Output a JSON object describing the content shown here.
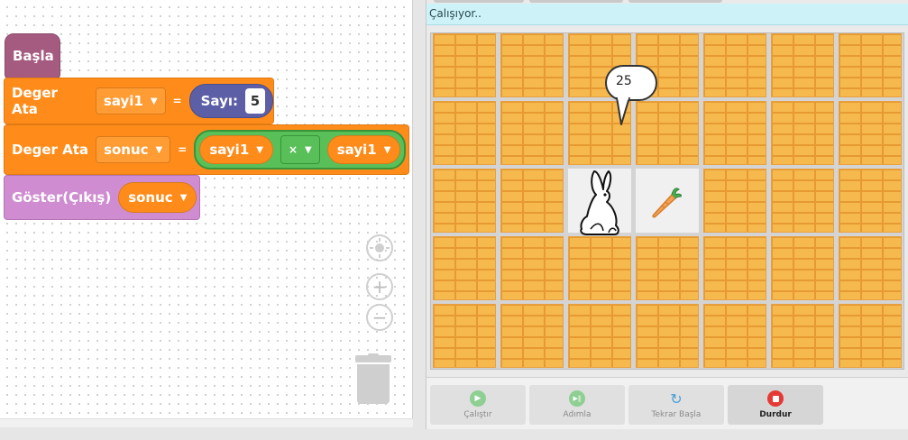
{
  "workspace": {
    "start_block": {
      "label": "Başla"
    },
    "set_block_1": {
      "label": "Deger Ata",
      "variable": "sayi1",
      "equals": "=",
      "value_label": "Sayı:",
      "value": "5"
    },
    "set_block_2": {
      "label": "Deger Ata",
      "variable": "sonuc",
      "equals": "=",
      "left_operand": "sayi1",
      "operator": "×",
      "right_operand": "sayi1"
    },
    "show_block": {
      "label": "Göster(Çıkış)",
      "variable": "sonuc"
    },
    "icons": [
      "center-icon",
      "zoom-in-icon",
      "zoom-out-icon",
      "trash-icon"
    ]
  },
  "stage": {
    "status_text": "Çalışıyor..",
    "speech_bubble": "25",
    "colors": {
      "status_bg": "#cdf3f8",
      "brick": "#f6b94e",
      "stop": "#e53935",
      "run": "#66bb6a"
    }
  },
  "controls": [
    {
      "label": "Çalıştır",
      "icon": "play-icon"
    },
    {
      "label": "Adımla",
      "icon": "step-icon"
    },
    {
      "label": "Tekrar Başla",
      "icon": "restart-icon"
    },
    {
      "label": "Durdur",
      "icon": "stop-icon"
    }
  ]
}
